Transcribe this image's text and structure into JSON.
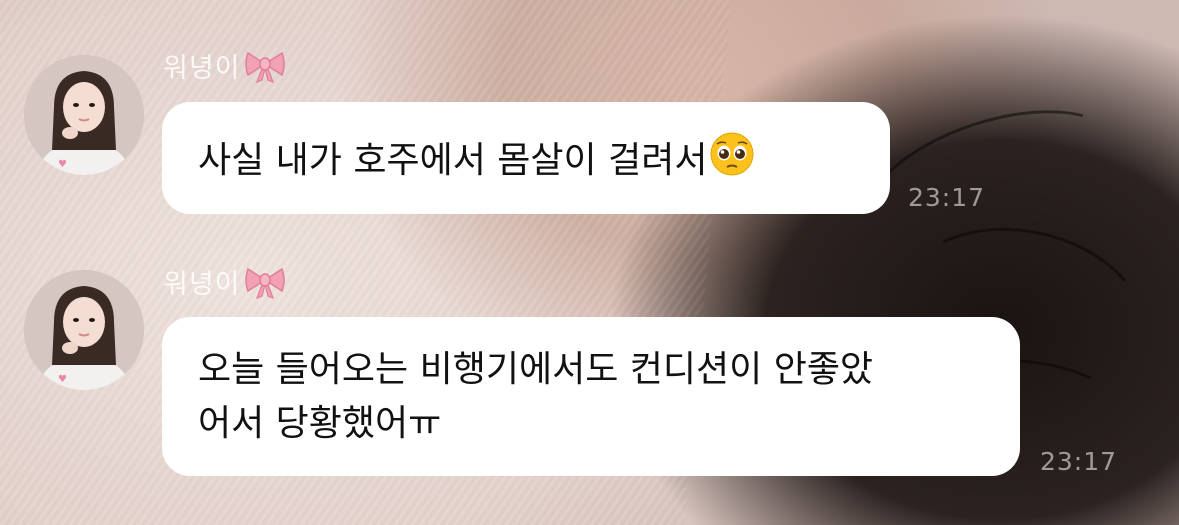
{
  "chat": {
    "messages": [
      {
        "sender": "워녕이",
        "text": "사실 내가 호주에서 몸살이 걸려서",
        "emoji": "pleading-face-icon",
        "time": "23:17"
      },
      {
        "sender": "워녕이",
        "text_line1": "오늘 들어오는 비행기에서도 컨디션이 안좋았",
        "text_line2": "어서 당황했어ㅠ",
        "time": "23:17"
      }
    ]
  },
  "colors": {
    "bubble": "#ffffff",
    "text": "#111111",
    "bow": "#f2a0b4"
  }
}
